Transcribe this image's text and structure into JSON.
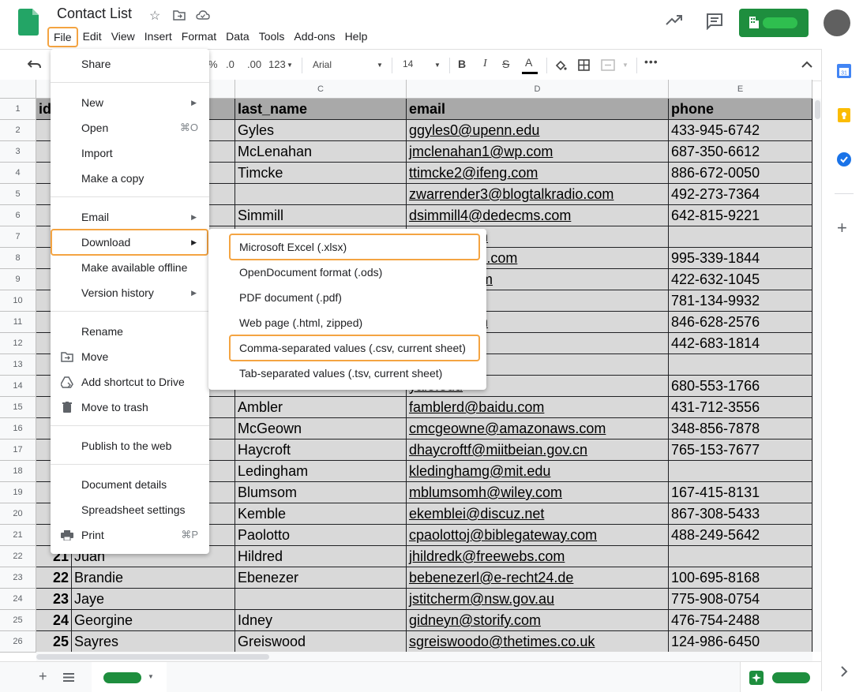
{
  "doc": {
    "title": "Contact List"
  },
  "menubar": [
    "File",
    "Edit",
    "View",
    "Insert",
    "Format",
    "Data",
    "Tools",
    "Add-ons",
    "Help"
  ],
  "toolbar": {
    "percent": "%",
    "dec_less": ".0",
    "dec_more": ".00",
    "format_more": "123",
    "font": "Arial",
    "font_size": "14",
    "bold": "B",
    "italic": "I",
    "text_color": "A"
  },
  "columns": [
    "C",
    "D",
    "E"
  ],
  "rows": [
    "1",
    "2",
    "3",
    "4",
    "5",
    "6",
    "7",
    "8",
    "9",
    "10",
    "11",
    "12",
    "13",
    "14",
    "15",
    "16",
    "17",
    "18",
    "19",
    "20",
    "21",
    "22",
    "23",
    "24",
    "25",
    "26"
  ],
  "sheet": {
    "header": {
      "id": "id",
      "last_name": "last_name",
      "email": "email",
      "phone": "phone"
    },
    "data": [
      {
        "id": "",
        "first": "",
        "last": "Gyles",
        "email": "ggyles0@upenn.edu",
        "phone": "433-945-6742"
      },
      {
        "id": "",
        "first": "",
        "last": "McLenahan",
        "email": "jmclenahan1@wp.com",
        "phone": "687-350-6612"
      },
      {
        "id": "",
        "first": "",
        "last": "Timcke",
        "email": "ttimcke2@ifeng.com",
        "phone": "886-672-0050"
      },
      {
        "id": "",
        "first": "",
        "last": "",
        "email": "zwarrender3@blogtalkradio.com",
        "phone": "492-273-7364"
      },
      {
        "id": "",
        "first": "",
        "last": "Simmill",
        "email": "dsimmill4@dedecms.com",
        "phone": "642-815-9221"
      },
      {
        "id": "",
        "first": "",
        "last": "",
        "email": "yolasite.com",
        "phone": ""
      },
      {
        "id": "",
        "first": "",
        "last": "",
        "email": "no6@forbes.com",
        "phone": "995-339-1844"
      },
      {
        "id": "",
        "first": "",
        "last": "",
        "email": "diatimes.com",
        "phone": "422-632-1045"
      },
      {
        "id": "",
        "first": "",
        "last": "",
        "email": "cmu.edu",
        "phone": "781-134-9932"
      },
      {
        "id": "",
        "first": "",
        "last": "",
        "email": "yolasite.com",
        "phone": "846-628-2576"
      },
      {
        "id": "",
        "first": "",
        "last": "",
        "email": "udflare.com",
        "phone": "442-683-1814"
      },
      {
        "id": "",
        "first": "",
        "last": "",
        "email": "uol.com.br",
        "phone": ""
      },
      {
        "id": "",
        "first": "",
        "last": "",
        "email": "yale.edu",
        "phone": "680-553-1766"
      },
      {
        "id": "",
        "first": "",
        "last": "Ambler",
        "email": "famblerd@baidu.com",
        "phone": "431-712-3556"
      },
      {
        "id": "",
        "first": "",
        "last": "McGeown",
        "email": "cmcgeowne@amazonaws.com",
        "phone": "348-856-7878"
      },
      {
        "id": "",
        "first": "",
        "last": "Haycroft",
        "email": "dhaycroftf@miitbeian.gov.cn",
        "phone": "765-153-7677"
      },
      {
        "id": "",
        "first": "",
        "last": "Ledingham",
        "email": "kledinghamg@mit.edu",
        "phone": ""
      },
      {
        "id": "",
        "first": "",
        "last": "Blumsom",
        "email": "mblumsomh@wiley.com",
        "phone": "167-415-8131"
      },
      {
        "id": "",
        "first": "",
        "last": "Kemble",
        "email": "ekemblei@discuz.net",
        "phone": "867-308-5433"
      },
      {
        "id": "",
        "first": "",
        "last": "Paolotto",
        "email": "cpaolottoj@biblegateway.com",
        "phone": "488-249-5642"
      },
      {
        "id": "21",
        "first": "Juan",
        "last": "Hildred",
        "email": "jhildredk@freewebs.com",
        "phone": ""
      },
      {
        "id": "22",
        "first": "Brandie",
        "last": "Ebenezer",
        "email": "bebenezerl@e-recht24.de",
        "phone": "100-695-8168"
      },
      {
        "id": "23",
        "first": "Jaye",
        "last": "",
        "email": "jstitcherm@nsw.gov.au",
        "phone": "775-908-0754"
      },
      {
        "id": "24",
        "first": "Georgine",
        "last": "Idney",
        "email": "gidneyn@storify.com",
        "phone": "476-754-2488"
      },
      {
        "id": "25",
        "first": "Sayres",
        "last": "Greiswood",
        "email": "sgreiswoodo@thetimes.co.uk",
        "phone": "124-986-6450"
      }
    ]
  },
  "file_menu": {
    "share": "Share",
    "new": "New",
    "open": "Open",
    "open_shortcut": "⌘O",
    "import": "Import",
    "make_copy": "Make a copy",
    "email": "Email",
    "download": "Download",
    "offline": "Make available offline",
    "version_history": "Version history",
    "rename": "Rename",
    "move": "Move",
    "add_shortcut": "Add shortcut to Drive",
    "trash": "Move to trash",
    "publish": "Publish to the web",
    "details": "Document details",
    "settings": "Spreadsheet settings",
    "print": "Print",
    "print_shortcut": "⌘P"
  },
  "download_menu": {
    "xlsx": "Microsoft Excel (.xlsx)",
    "ods": "OpenDocument format (.ods)",
    "pdf": "PDF document (.pdf)",
    "html": "Web page (.html, zipped)",
    "csv": "Comma-separated values (.csv, current sheet)",
    "tsv": "Tab-separated values (.tsv, current sheet)"
  },
  "colors": {
    "highlight": "#f4a442",
    "brand_green": "#1e8e3e",
    "cell_bg": "#d9d9d9",
    "header_bg": "#a9a9a9"
  }
}
